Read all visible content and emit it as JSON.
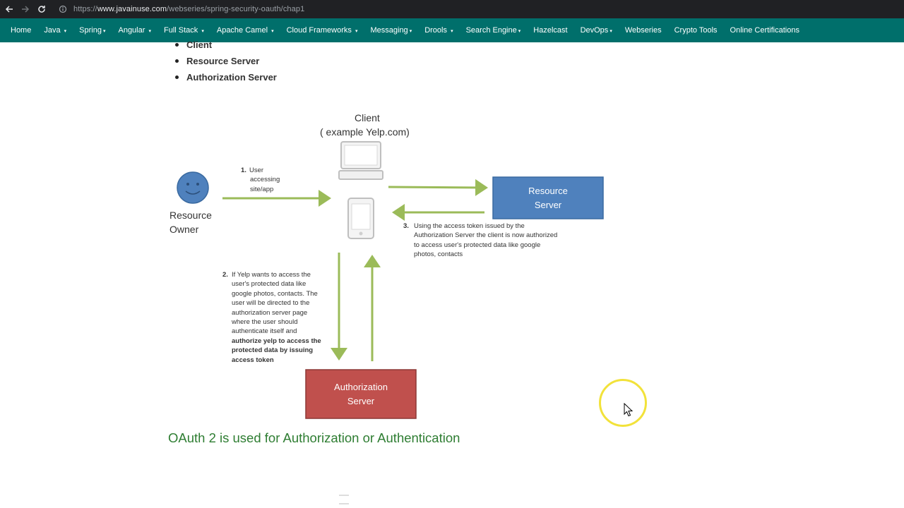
{
  "browser": {
    "url_scheme": "https://",
    "url_host": "www.javainuse.com",
    "url_path": "/webseries/spring-security-oauth/chap1"
  },
  "navbar": {
    "items": [
      {
        "label": "Home",
        "dropdown": false
      },
      {
        "label": "Java",
        "dropdown": true
      },
      {
        "label": "Spring",
        "dropdown": true
      },
      {
        "label": "Angular",
        "dropdown": true
      },
      {
        "label": "Full Stack",
        "dropdown": true
      },
      {
        "label": "Apache Camel",
        "dropdown": true
      },
      {
        "label": "Cloud Frameworks",
        "dropdown": true
      },
      {
        "label": "Messaging",
        "dropdown": true
      },
      {
        "label": "Drools",
        "dropdown": true
      },
      {
        "label": "Search Engine",
        "dropdown": true
      },
      {
        "label": "Hazelcast",
        "dropdown": false
      },
      {
        "label": "DevOps",
        "dropdown": true
      },
      {
        "label": "Webseries",
        "dropdown": false
      },
      {
        "label": "Crypto Tools",
        "dropdown": false
      },
      {
        "label": "Online Certifications",
        "dropdown": false
      }
    ],
    "caret": "▾"
  },
  "content": {
    "bullets": [
      "Client",
      "Resource Server",
      "Authorization Server"
    ],
    "heading": "OAuth 2 is used for Authorization or Authentication"
  },
  "diagram": {
    "client_title": "Client",
    "client_subtitle": "( example Yelp.com)",
    "resource_owner_line1": "Resource",
    "resource_owner_line2": "Owner",
    "resource_server_line1": "Resource",
    "resource_server_line2": "Server",
    "auth_server_line1": "Authorization",
    "auth_server_line2": "Server",
    "step1_num": "1.",
    "step1_lines": [
      "User",
      "accessing",
      "site/app"
    ],
    "step3_num": "3.",
    "step3_lines": [
      "Using the access token issued by the",
      "Authorization Server the client is now authorized",
      "to access   user's protected data like google",
      "photos, contacts"
    ],
    "step2_num": "2.",
    "step2_lines": [
      "If Yelp wants to access the",
      "user's protected data like",
      "google photos, contacts. The",
      "user will be directed to the",
      "authorization server page",
      "where the user should",
      "authenticate itself and"
    ],
    "step2_bold_lines": [
      "authorize yelp to access the",
      "protected data by issuing",
      "access token"
    ],
    "colors": {
      "arrow": "#9bbb59",
      "resource_server": "#4f81bd",
      "auth_server": "#c0504d",
      "smiley": "#4f81bd"
    }
  },
  "icons": {
    "back": "arrow-left-icon",
    "forward": "arrow-right-icon",
    "reload": "reload-icon",
    "site_info": "site-info-icon",
    "smiley": "smiley-face-icon",
    "laptop": "laptop-icon",
    "phone": "mobile-phone-icon",
    "cursor": "mouse-pointer-icon"
  }
}
